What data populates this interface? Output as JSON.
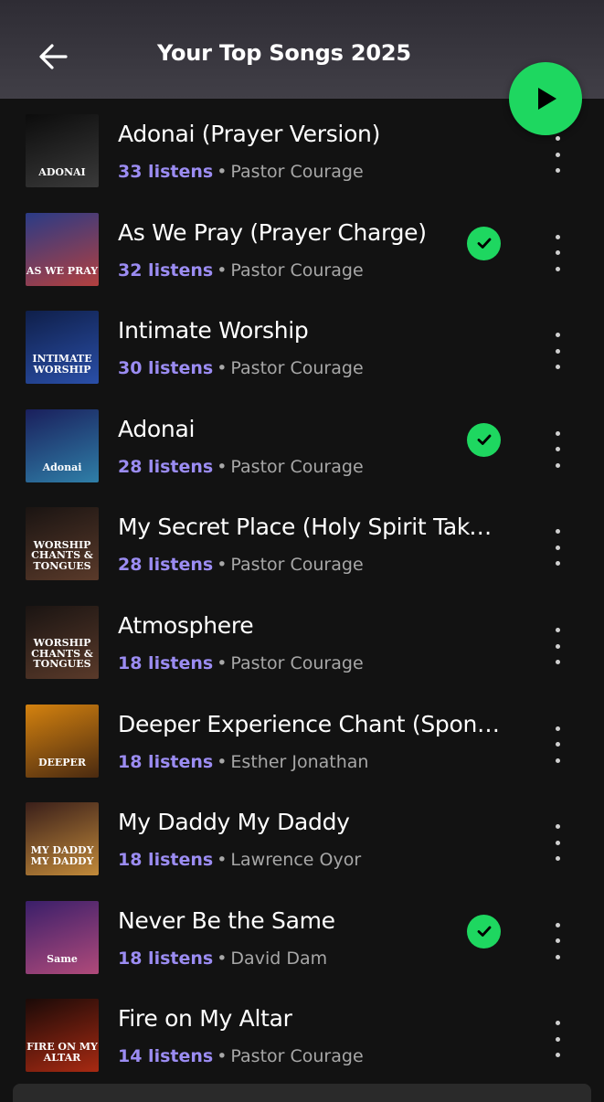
{
  "header": {
    "title": "Your Top Songs 2025",
    "back_icon": "arrow-left-icon",
    "play_icon": "play-icon",
    "accent": "#1ed760"
  },
  "songs": [
    {
      "title": "Adonai (Prayer Version)",
      "listens": "33 listens",
      "artist": "Pastor Courage",
      "saved": false,
      "art_text": "ADONAI",
      "art_colors": [
        "#0c0c0c",
        "#3a3a3a"
      ]
    },
    {
      "title": "As We Pray (Prayer Charge)",
      "listens": "32 listens",
      "artist": "Pastor Courage",
      "saved": true,
      "art_text": "AS WE PRAY",
      "art_colors": [
        "#2a3b86",
        "#b3403f"
      ]
    },
    {
      "title": "Intimate Worship",
      "listens": "30 listens",
      "artist": "Pastor Courage",
      "saved": false,
      "art_text": "INTIMATE WORSHIP",
      "art_colors": [
        "#0f1f4a",
        "#2a4fa8"
      ]
    },
    {
      "title": "Adonai",
      "listens": "28 listens",
      "artist": "Pastor Courage",
      "saved": true,
      "art_text": "Adonai",
      "art_colors": [
        "#1a1f5c",
        "#2f7fa8"
      ]
    },
    {
      "title": "My Secret Place (Holy Spirit Take …",
      "listens": "28 listens",
      "artist": "Pastor Courage",
      "saved": false,
      "art_text": "WORSHIP CHANTS & TONGUES",
      "art_colors": [
        "#1a1412",
        "#5a3a2a"
      ]
    },
    {
      "title": "Atmosphere",
      "listens": "18 listens",
      "artist": "Pastor Courage",
      "saved": false,
      "art_text": "WORSHIP CHANTS & TONGUES",
      "art_colors": [
        "#1a1412",
        "#5a3a2a"
      ]
    },
    {
      "title": "Deeper Experience Chant (Spont…",
      "listens": "18 listens",
      "artist": "Esther Jonathan",
      "saved": false,
      "art_text": "DEEPER",
      "art_colors": [
        "#d4820f",
        "#4a2a10"
      ]
    },
    {
      "title": "My Daddy My Daddy",
      "listens": "18 listens",
      "artist": "Lawrence Oyor",
      "saved": false,
      "art_text": "MY DADDY MY DADDY",
      "art_colors": [
        "#3a1f1a",
        "#c28a3a"
      ]
    },
    {
      "title": "Never Be the Same",
      "listens": "18 listens",
      "artist": "David Dam",
      "saved": true,
      "art_text": "Same",
      "art_colors": [
        "#3a1f6a",
        "#b04a7a"
      ]
    },
    {
      "title": "Fire on My Altar",
      "listens": "14 listens",
      "artist": "Pastor Courage",
      "saved": false,
      "art_text": "FIRE ON MY ALTAR",
      "art_colors": [
        "#1a0a08",
        "#a82a12"
      ]
    }
  ],
  "colors": {
    "background": "#121212",
    "listens": "#9b8cf2",
    "subtext": "#a7a7a7",
    "saved_check": "#1ed760"
  }
}
